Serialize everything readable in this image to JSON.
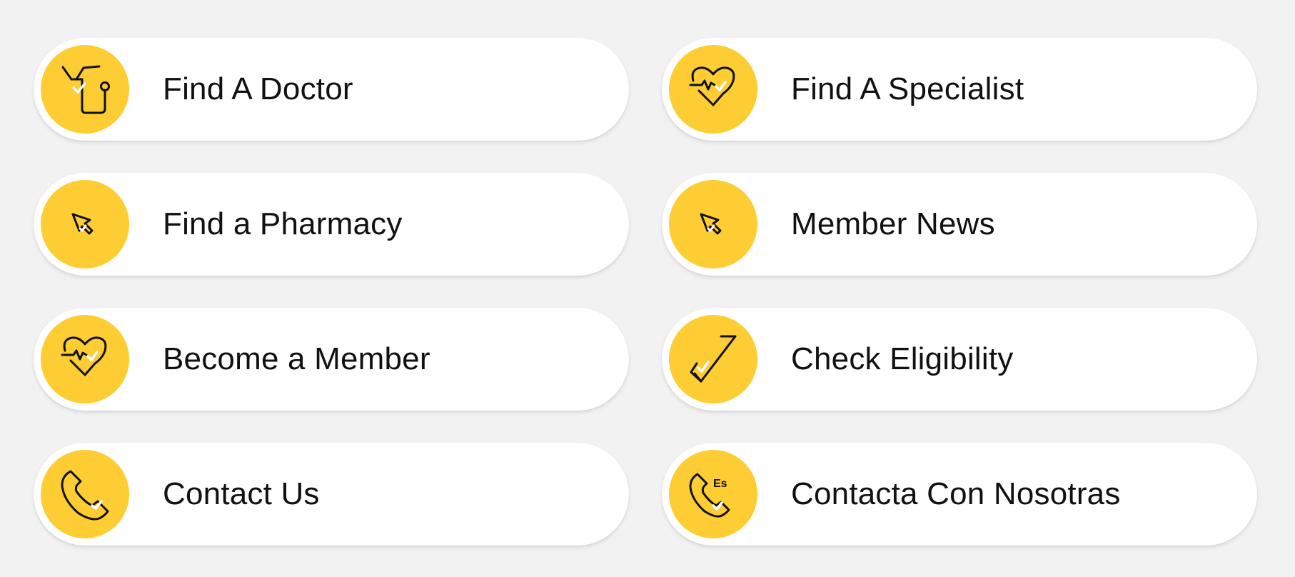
{
  "accent_color": "#fdcd33",
  "background_color": "#f2f2f2",
  "buttons": [
    {
      "label": "Find A Doctor",
      "icon": "stethoscope-icon"
    },
    {
      "label": "Find A Specialist",
      "icon": "heartbeat-icon"
    },
    {
      "label": "Find a Pharmacy",
      "icon": "cursor-pointer-icon"
    },
    {
      "label": "Member News",
      "icon": "cursor-pointer-icon"
    },
    {
      "label": "Become a Member",
      "icon": "heartbeat-icon"
    },
    {
      "label": "Check Eligibility",
      "icon": "checkmark-icon"
    },
    {
      "label": "Contact Us",
      "icon": "phone-icon"
    },
    {
      "label": "Contacta Con Nosotras",
      "icon": "phone-spanish-icon",
      "icon_text": "Es"
    }
  ]
}
